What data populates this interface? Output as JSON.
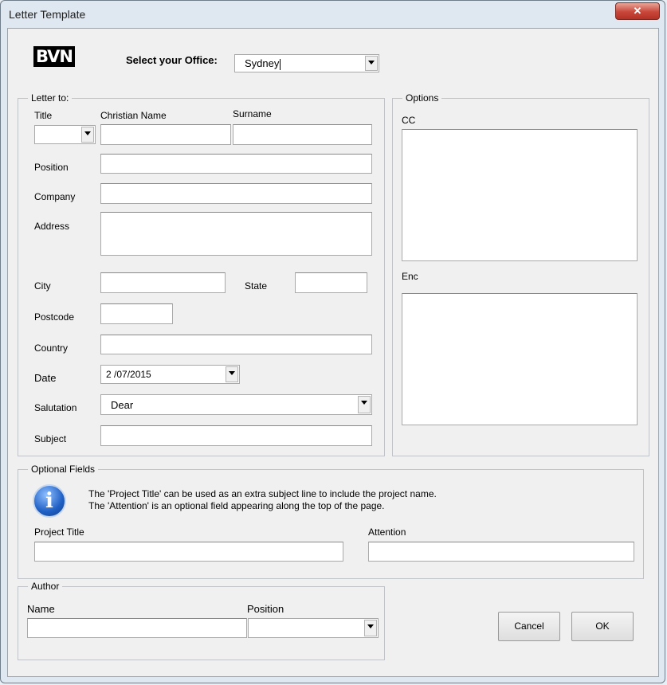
{
  "window": {
    "title": "Letter Template",
    "close_glyph": "✕"
  },
  "header": {
    "logo_text": "BVN",
    "office_label": "Select your Office:",
    "office_value": "Sydney"
  },
  "letter_to": {
    "legend": "Letter to:",
    "title_label": "Title",
    "title_value": "",
    "christian_name_label": "Christian Name",
    "surname_label": "Surname",
    "position_label": "Position",
    "company_label": "Company",
    "address_label": "Address",
    "city_label": "City",
    "state_label": "State",
    "postcode_label": "Postcode",
    "country_label": "Country",
    "date_label": "Date",
    "date_value": "2 /07/2015",
    "salutation_label": "Salutation",
    "salutation_value": "Dear",
    "subject_label": "Subject"
  },
  "options": {
    "legend": "Options",
    "cc_label": "CC",
    "enc_label": "Enc"
  },
  "optional_fields": {
    "legend": "Optional Fields",
    "info_icon": "i",
    "info_line1": "The 'Project Title' can be used as an extra subject line to include the project name.",
    "info_line2": "The 'Attention' is an optional field appearing along the top of the page.",
    "project_title_label": "Project Title",
    "attention_label": "Attention"
  },
  "author": {
    "legend": "Author",
    "name_label": "Name",
    "position_label": "Position",
    "position_value": ""
  },
  "buttons": {
    "cancel": "Cancel",
    "ok": "OK"
  },
  "icons": {
    "close": "close-icon",
    "info": "info-icon",
    "dropdown": "chevron-down-icon"
  },
  "colors": {
    "close_button": "#c8473a",
    "info_icon": "#1f5fc4",
    "window_frame": "#dfe8f1",
    "client_bg": "#f0f0f0"
  }
}
